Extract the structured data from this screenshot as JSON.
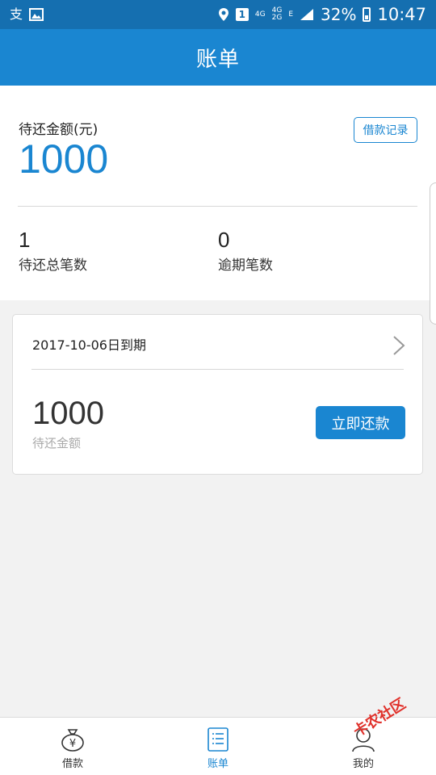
{
  "status_bar": {
    "carrier_icons": [
      "alipay-icon",
      "image-icon"
    ],
    "sim_badge": "1",
    "network_top": "4G",
    "network_pair_top": "4G",
    "network_pair_bottom": "2G",
    "edge_label": "E",
    "battery_percent": "32%",
    "time": "10:47"
  },
  "header": {
    "title": "账单"
  },
  "summary": {
    "pending_label": "待还金额(元)",
    "pending_amount": "1000",
    "loan_record_label": "借款记录",
    "total_count": "1",
    "total_count_label": "待还总笔数",
    "overdue_count": "0",
    "overdue_count_label": "逾期笔数"
  },
  "bill": {
    "due_text": "2017-10-06日到期",
    "amount": "1000",
    "amount_label": "待还金额",
    "repay_label": "立即还款"
  },
  "bottom_nav": {
    "items": [
      {
        "label": "借款",
        "icon": "money-bag-icon"
      },
      {
        "label": "账单",
        "icon": "bill-list-icon"
      },
      {
        "label": "我的",
        "icon": "user-icon"
      }
    ],
    "active_index": 1
  },
  "watermark": {
    "text": "卡农社区"
  },
  "colors": {
    "primary": "#1a86d1",
    "status_bar": "#156fb0",
    "background": "#f2f2f2"
  }
}
